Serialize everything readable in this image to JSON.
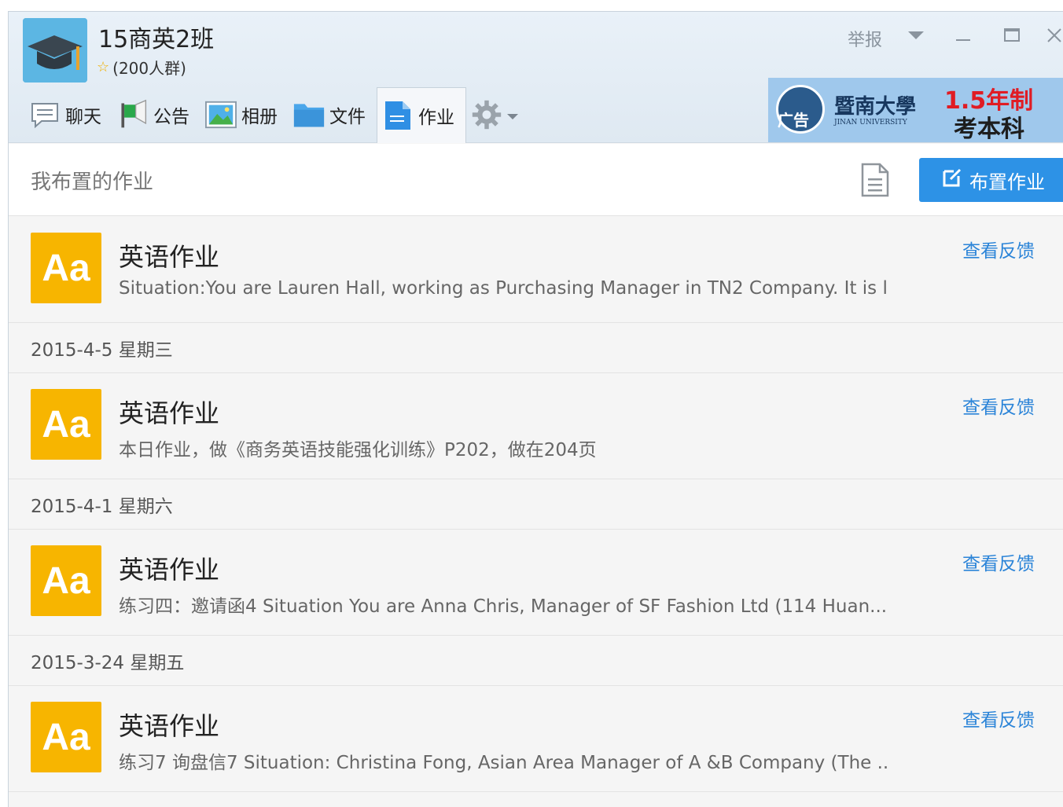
{
  "header": {
    "group_name": "15商英2班",
    "group_meta": "(200人群)",
    "report_label": "举报",
    "tabs": [
      {
        "label": "聊天",
        "icon": "chat-icon"
      },
      {
        "label": "公告",
        "icon": "announcement-flag-icon"
      },
      {
        "label": "相册",
        "icon": "album-picture-icon"
      },
      {
        "label": "文件",
        "icon": "folder-icon"
      },
      {
        "label": "作业",
        "icon": "homework-doc-icon"
      }
    ],
    "settings_icon": "gear-icon"
  },
  "ad": {
    "badge": "广告",
    "university": "暨南大學",
    "university_en": "JINAN UNIVERSITY",
    "line1": "1.5年制",
    "line2": "考本科"
  },
  "subbar": {
    "title": "我布置的作业",
    "assign_button": "布置作业"
  },
  "list": {
    "items": [
      {
        "icon_text": "Aa",
        "title": "英语作业",
        "desc": "Situation:You are Lauren Hall, working as Purchasing Manager in TN2 Company. It is l...",
        "link": "查看反馈",
        "date": "2015-4-5 星期三"
      },
      {
        "icon_text": "Aa",
        "title": "英语作业",
        "desc": "本日作业，做《商务英语技能强化训练》P202，做在204页",
        "link": "查看反馈",
        "date": "2015-4-1 星期六"
      },
      {
        "icon_text": "Aa",
        "title": "英语作业",
        "desc": "练习四：邀请函4 Situation  You are Anna Chris, Manager of SF Fashion Ltd (114 Huan...",
        "link": "查看反馈",
        "date": "2015-3-24 星期五"
      },
      {
        "icon_text": "Aa",
        "title": "英语作业",
        "desc": "练习7 询盘信7  Situation: Christina Fong, Asian Area Manager of A &B Company (The ...",
        "link": "查看反馈"
      }
    ]
  }
}
